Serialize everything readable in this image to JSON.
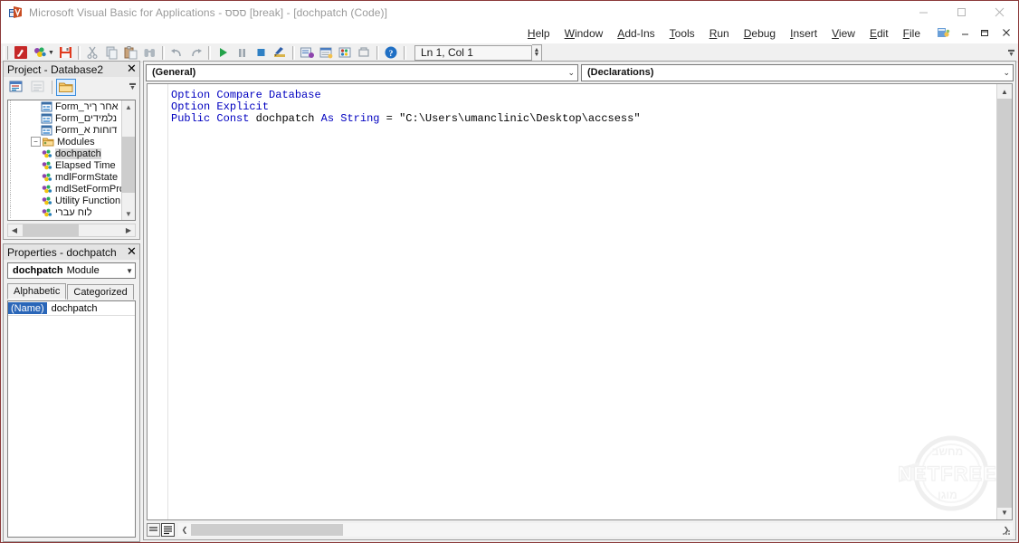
{
  "window": {
    "title": "Microsoft Visual Basic for Applications - ססס [break] - [dochpatch (Code)]",
    "app_icon": "vba-app-icon",
    "minimize": "minimize-icon",
    "maximize": "maximize-icon",
    "close": "close-icon"
  },
  "menu": {
    "items": [
      {
        "label": "Help",
        "accel": "H"
      },
      {
        "label": "Window",
        "accel": "W"
      },
      {
        "label": "Add-Ins",
        "accel": "A"
      },
      {
        "label": "Tools",
        "accel": "T"
      },
      {
        "label": "Run",
        "accel": "R"
      },
      {
        "label": "Debug",
        "accel": "D"
      },
      {
        "label": "Insert",
        "accel": "I"
      },
      {
        "label": "View",
        "accel": "V"
      },
      {
        "label": "Edit",
        "accel": "E"
      },
      {
        "label": "File",
        "accel": "F"
      }
    ],
    "mdi_icon": "mdi-document-icon",
    "mdi_minimize": "mdi-minimize-icon",
    "mdi_restore": "mdi-restore-icon",
    "mdi_close": "mdi-close-icon"
  },
  "toolbar": {
    "buttons": [
      {
        "name": "view-microsoft-access-button",
        "icon": "access-switch-icon"
      },
      {
        "name": "insert-object-button",
        "icon": "insert-module-icon"
      },
      {
        "name": "insert-dropdown-button",
        "icon": "chevron-down-icon"
      },
      {
        "name": "save-button",
        "icon": "save-disk-icon"
      },
      {
        "name": "cut-button",
        "icon": "scissors-icon"
      },
      {
        "name": "copy-button",
        "icon": "copy-icon"
      },
      {
        "name": "paste-button",
        "icon": "paste-icon"
      },
      {
        "name": "find-button",
        "icon": "binoculars-icon"
      },
      {
        "name": "undo-button",
        "icon": "undo-arrow-icon"
      },
      {
        "name": "redo-button",
        "icon": "redo-arrow-icon"
      },
      {
        "name": "run-button",
        "icon": "play-triangle-icon"
      },
      {
        "name": "break-button",
        "icon": "pause-icon"
      },
      {
        "name": "reset-button",
        "icon": "stop-square-icon"
      },
      {
        "name": "design-mode-button",
        "icon": "design-mode-icon"
      },
      {
        "name": "project-explorer-button",
        "icon": "project-explorer-icon"
      },
      {
        "name": "properties-window-button",
        "icon": "properties-window-icon"
      },
      {
        "name": "object-browser-button",
        "icon": "object-browser-icon"
      },
      {
        "name": "toolbox-button",
        "icon": "toolbox-hammer-icon"
      },
      {
        "name": "help-button",
        "icon": "help-question-icon"
      }
    ],
    "position_label": "Ln 1, Col 1",
    "overflow": "toolbar-overflow-icon"
  },
  "project_panel": {
    "title": "Project - Database2",
    "close": "close-icon",
    "toolbar": [
      {
        "name": "view-code-button",
        "icon": "view-code-icon",
        "active": false
      },
      {
        "name": "view-object-button",
        "icon": "view-object-icon",
        "active": false
      },
      {
        "name": "toggle-folders-button",
        "icon": "folder-icon",
        "active": true
      }
    ],
    "tree": [
      {
        "label": "Form_אחר ךיר",
        "icon": "form-icon",
        "depth": 3,
        "selected": false
      },
      {
        "label": "Form_נלמידים",
        "icon": "form-icon",
        "depth": 3,
        "selected": false
      },
      {
        "label": "Form_דוחות א",
        "icon": "form-icon",
        "depth": 3,
        "selected": false
      },
      {
        "label": "Modules",
        "icon": "folder-open-icon",
        "depth": 2,
        "selected": false,
        "expander": "minus"
      },
      {
        "label": "dochpatch",
        "icon": "module-icon",
        "depth": 3,
        "selected": true
      },
      {
        "label": "Elapsed Time",
        "icon": "module-icon",
        "depth": 3,
        "selected": false
      },
      {
        "label": "mdlFormState",
        "icon": "module-icon",
        "depth": 3,
        "selected": false
      },
      {
        "label": "mdlSetFormPro",
        "icon": "module-icon",
        "depth": 3,
        "selected": false
      },
      {
        "label": "Utility Function",
        "icon": "module-icon",
        "depth": 3,
        "selected": false
      },
      {
        "label": "לוח עברי",
        "icon": "module-icon",
        "depth": 3,
        "selected": false
      }
    ],
    "scroll_up": "chevron-up-icon",
    "scroll_down": "chevron-down-icon",
    "scroll_left": "chevron-left-icon",
    "scroll_right": "chevron-right-icon"
  },
  "properties_panel": {
    "title": "Properties - dochpatch",
    "close": "close-icon",
    "object_name": "dochpatch",
    "object_type": "Module",
    "dropdown_icon": "chevron-down-icon",
    "tabs": [
      {
        "label": "Alphabetic",
        "active": true
      },
      {
        "label": "Categorized",
        "active": false
      }
    ],
    "rows": [
      {
        "key": "(Name)",
        "value": "dochpatch"
      }
    ]
  },
  "code_window": {
    "object_combo": "(General)",
    "procedure_combo": "(Declarations)",
    "dropdown_icon": "chevron-down-icon",
    "lines": [
      [
        {
          "t": "Option",
          "c": "kw"
        },
        {
          "t": " ",
          "c": "pl"
        },
        {
          "t": "Compare",
          "c": "kw"
        },
        {
          "t": " ",
          "c": "pl"
        },
        {
          "t": "Database",
          "c": "kw"
        }
      ],
      [
        {
          "t": "Option",
          "c": "kw"
        },
        {
          "t": " ",
          "c": "pl"
        },
        {
          "t": "Explicit",
          "c": "kw"
        }
      ],
      [
        {
          "t": "Public",
          "c": "kw"
        },
        {
          "t": " ",
          "c": "pl"
        },
        {
          "t": "Const",
          "c": "kw"
        },
        {
          "t": " dochpatch ",
          "c": "pl"
        },
        {
          "t": "As",
          "c": "kw"
        },
        {
          "t": " ",
          "c": "pl"
        },
        {
          "t": "String",
          "c": "kw"
        },
        {
          "t": " = \"C:\\Users\\umanclinic\\Desktop\\accsess\"",
          "c": "pl"
        }
      ]
    ],
    "view_procedure_button": "procedure-view-icon",
    "view_fullmodule_button": "full-module-view-icon",
    "scroll_up": "chevron-up-icon",
    "scroll_down": "chevron-down-icon",
    "scroll_left": "chevron-left-icon",
    "scroll_right": "chevron-right-icon",
    "resize_grip": "resize-grip-icon"
  },
  "watermark": {
    "brand": "NETFREE",
    "top_text": "מחשב",
    "bottom_text": "מוגן",
    "icon": "netfree-logo-icon"
  },
  "colors": {
    "window_border": "#8b3a3a",
    "keyword": "#0000c0",
    "panel_bg": "#f0f0f0",
    "selection": "#2a66b8",
    "accent": "#3c8ddb"
  }
}
